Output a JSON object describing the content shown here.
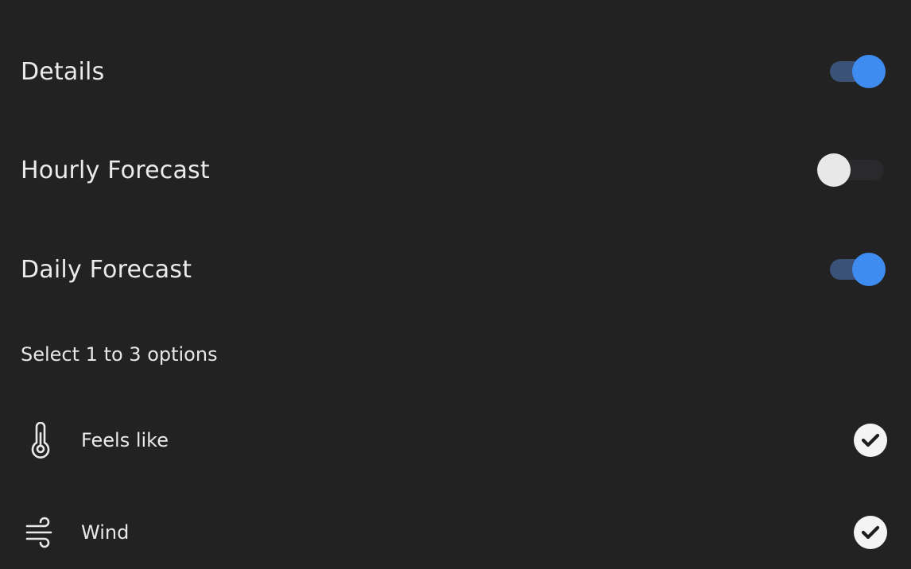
{
  "toggles": [
    {
      "label": "Details",
      "state": "on"
    },
    {
      "label": "Hourly Forecast",
      "state": "off"
    },
    {
      "label": "Daily Forecast",
      "state": "on"
    }
  ],
  "options_header": "Select 1 to 3 options",
  "options": [
    {
      "label": "Feels like",
      "icon": "thermometer-icon",
      "checked": true
    },
    {
      "label": "Wind",
      "icon": "wind-icon",
      "checked": true
    }
  ],
  "colors": {
    "background": "#222223",
    "accent": "#3f8cf0",
    "accent_track": "#3a5277",
    "text": "#ebebeb"
  }
}
